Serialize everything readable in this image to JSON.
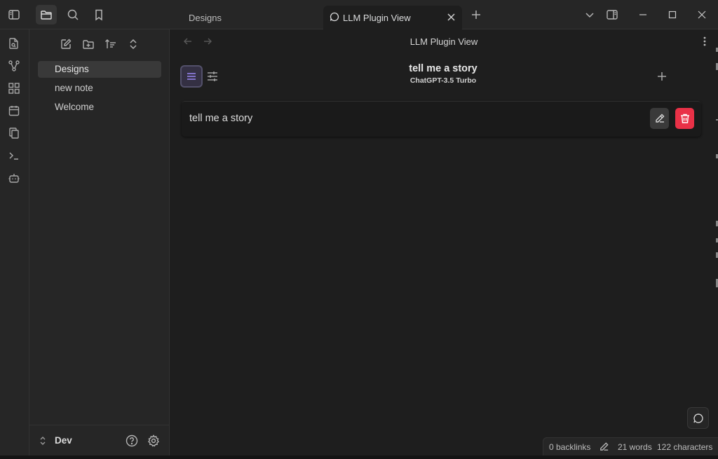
{
  "titlebar": {
    "tabs": [
      {
        "label": "Designs",
        "active": false
      },
      {
        "label": "LLM Plugin View",
        "active": true
      }
    ]
  },
  "sidebar": {
    "files": [
      {
        "label": "Designs",
        "active": true
      },
      {
        "label": "new note",
        "active": false
      },
      {
        "label": "Welcome",
        "active": false
      }
    ],
    "vault_name": "Dev"
  },
  "main": {
    "view_title": "LLM Plugin View",
    "chat_title": "tell me a story",
    "model": "ChatGPT-3.5 Turbo",
    "history": [
      {
        "text": "tell me a story"
      }
    ]
  },
  "status": {
    "backlinks": "0 backlinks",
    "words": "21 words",
    "characters": "122 characters"
  },
  "colors": {
    "accent": "#9b87f5",
    "danger": "#e93147",
    "background": "#1e1e1e",
    "panel": "#262626"
  }
}
